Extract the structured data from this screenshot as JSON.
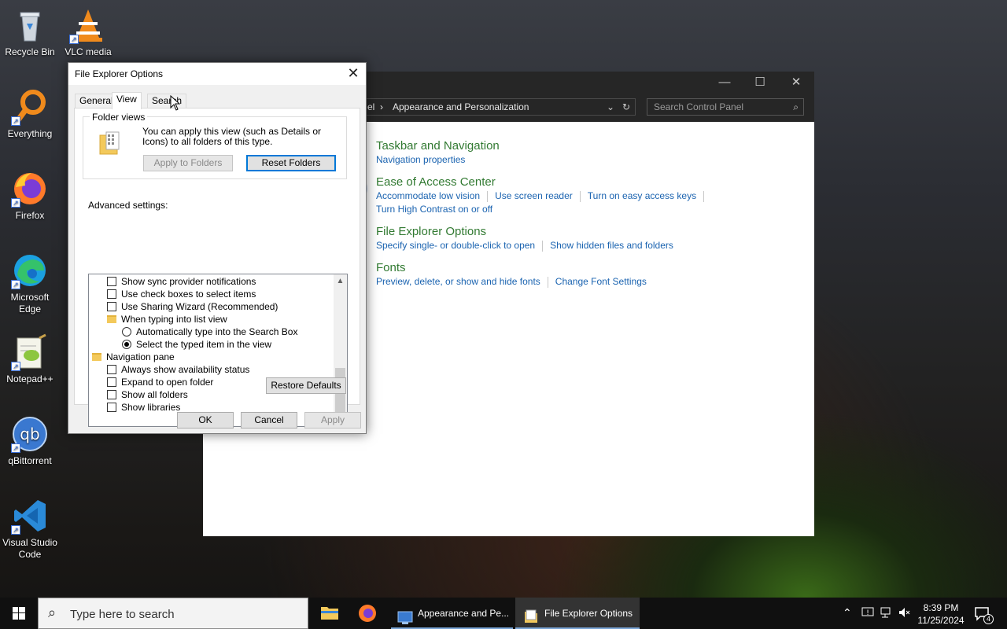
{
  "desktop": {
    "icons": [
      {
        "label": "Recycle Bin"
      },
      {
        "label": "VLC media"
      },
      {
        "label": "Everything"
      },
      {
        "label": "Firefox"
      },
      {
        "label": "Microsoft Edge"
      },
      {
        "label": "Notepad++"
      },
      {
        "label": "qBittorrent"
      },
      {
        "label": "Visual Studio Code"
      }
    ]
  },
  "control_panel": {
    "breadcrumb_prev": "el",
    "breadcrumb_arrow": "›",
    "breadcrumb_current": "Appearance and Personalization",
    "search_placeholder": "Search Control Panel",
    "categories": [
      {
        "title": "Taskbar and Navigation",
        "links": [
          "Navigation properties"
        ]
      },
      {
        "title": "Ease of Access Center",
        "links": [
          "Accommodate low vision",
          "Use screen reader",
          "Turn on easy access keys",
          "Turn High Contrast on or off"
        ]
      },
      {
        "title": "File Explorer Options",
        "links": [
          "Specify single- or double-click to open",
          "Show hidden files and folders"
        ]
      },
      {
        "title": "Fonts",
        "links": [
          "Preview, delete, or show and hide fonts",
          "Change Font Settings"
        ]
      }
    ]
  },
  "dialog": {
    "title": "File Explorer Options",
    "close": "✕",
    "tabs": [
      {
        "label": "General"
      },
      {
        "label": "View"
      },
      {
        "label": "Search"
      }
    ],
    "active_tab": "View",
    "folder_views_label": "Folder views",
    "folder_views_text": "You can apply this view (such as Details or Icons) to all folders of this type.",
    "apply_to_folders": "Apply to Folders",
    "reset_folders": "Reset Folders",
    "advanced_label": "Advanced settings:",
    "advanced_items": [
      {
        "type": "checkbox",
        "label": "Show sync provider notifications",
        "checked": false
      },
      {
        "type": "checkbox",
        "label": "Use check boxes to select items",
        "checked": false
      },
      {
        "type": "checkbox",
        "label": "Use Sharing Wizard (Recommended)",
        "checked": false
      },
      {
        "type": "folder",
        "label": "When typing into list view"
      },
      {
        "type": "radio",
        "label": "Automatically type into the Search Box",
        "checked": false
      },
      {
        "type": "radio",
        "label": "Select the typed item in the view",
        "checked": true
      },
      {
        "type": "folder-root",
        "label": "Navigation pane"
      },
      {
        "type": "checkbox",
        "label": "Always show availability status",
        "checked": false
      },
      {
        "type": "checkbox",
        "label": "Expand to open folder",
        "checked": false
      },
      {
        "type": "checkbox",
        "label": "Show all folders",
        "checked": false
      },
      {
        "type": "checkbox",
        "label": "Show libraries",
        "checked": false
      }
    ],
    "restore_defaults": "Restore Defaults",
    "ok": "OK",
    "cancel": "Cancel",
    "apply": "Apply"
  },
  "taskbar": {
    "search_placeholder": "Type here to search",
    "apps": [
      {
        "label": "Appearance and Pe..."
      },
      {
        "label": "File Explorer Options"
      }
    ],
    "time": "8:39 PM",
    "date": "11/25/2024",
    "notification_count": "4"
  }
}
